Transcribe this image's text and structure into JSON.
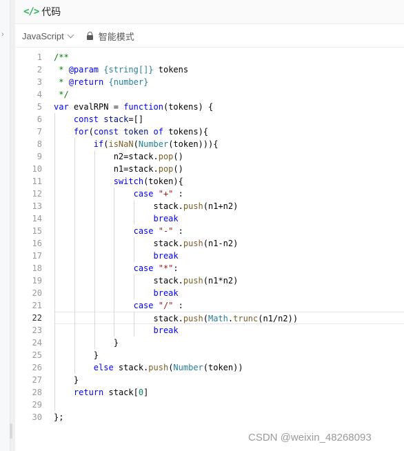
{
  "panel": {
    "title": "代码",
    "title_icon": "code-icon",
    "language_label": "JavaScript",
    "mode_label": "智能模式",
    "mode_icon": "lock-icon"
  },
  "editor": {
    "active_line": 22,
    "lines": [
      {
        "n": "1",
        "tokens": [
          {
            "t": "/**",
            "c": "com"
          }
        ]
      },
      {
        "n": "2",
        "tokens": [
          {
            "t": " * ",
            "c": "com"
          },
          {
            "t": "@param",
            "c": "tag"
          },
          {
            "t": " {string[]} ",
            "c": "type"
          },
          {
            "t": "tokens",
            "c": "op"
          }
        ]
      },
      {
        "n": "3",
        "tokens": [
          {
            "t": " * ",
            "c": "com"
          },
          {
            "t": "@return",
            "c": "tag"
          },
          {
            "t": " {number}",
            "c": "type"
          }
        ]
      },
      {
        "n": "4",
        "tokens": [
          {
            "t": " */",
            "c": "com"
          }
        ]
      },
      {
        "n": "5",
        "tokens": [
          {
            "t": "var",
            "c": "kw"
          },
          {
            "t": " evalRPN ",
            "c": "op"
          },
          {
            "t": "=",
            "c": "op"
          },
          {
            "t": " ",
            "c": "op"
          },
          {
            "t": "function",
            "c": "kw"
          },
          {
            "t": "(tokens) {",
            "c": "op"
          }
        ]
      },
      {
        "n": "6",
        "tokens": [
          {
            "t": "    ",
            "c": "op"
          },
          {
            "t": "const",
            "c": "kw"
          },
          {
            "t": " ",
            "c": "op"
          },
          {
            "t": "stack",
            "c": "var"
          },
          {
            "t": "=[]",
            "c": "op"
          }
        ]
      },
      {
        "n": "7",
        "tokens": [
          {
            "t": "    ",
            "c": "op"
          },
          {
            "t": "for",
            "c": "kw"
          },
          {
            "t": "(",
            "c": "op"
          },
          {
            "t": "const",
            "c": "kw"
          },
          {
            "t": " ",
            "c": "op"
          },
          {
            "t": "token",
            "c": "var"
          },
          {
            "t": " ",
            "c": "op"
          },
          {
            "t": "of",
            "c": "kw"
          },
          {
            "t": " tokens){",
            "c": "op"
          }
        ]
      },
      {
        "n": "8",
        "tokens": [
          {
            "t": "        ",
            "c": "op"
          },
          {
            "t": "if",
            "c": "kw"
          },
          {
            "t": "(",
            "c": "op"
          },
          {
            "t": "isNaN",
            "c": "fn"
          },
          {
            "t": "(",
            "c": "op"
          },
          {
            "t": "Number",
            "c": "type"
          },
          {
            "t": "(token))){",
            "c": "op"
          }
        ]
      },
      {
        "n": "9",
        "tokens": [
          {
            "t": "            n2=stack.",
            "c": "op"
          },
          {
            "t": "pop",
            "c": "fn"
          },
          {
            "t": "()",
            "c": "op"
          }
        ]
      },
      {
        "n": "10",
        "tokens": [
          {
            "t": "            n1=stack.",
            "c": "op"
          },
          {
            "t": "pop",
            "c": "fn"
          },
          {
            "t": "()",
            "c": "op"
          }
        ]
      },
      {
        "n": "11",
        "tokens": [
          {
            "t": "            ",
            "c": "op"
          },
          {
            "t": "switch",
            "c": "kw"
          },
          {
            "t": "(token){",
            "c": "op"
          }
        ]
      },
      {
        "n": "12",
        "tokens": [
          {
            "t": "                ",
            "c": "op"
          },
          {
            "t": "case",
            "c": "kw"
          },
          {
            "t": " ",
            "c": "op"
          },
          {
            "t": "\"+\"",
            "c": "str"
          },
          {
            "t": " :",
            "c": "op"
          }
        ]
      },
      {
        "n": "13",
        "tokens": [
          {
            "t": "                    stack.",
            "c": "op"
          },
          {
            "t": "push",
            "c": "fn"
          },
          {
            "t": "(n1+n2)",
            "c": "op"
          }
        ]
      },
      {
        "n": "14",
        "tokens": [
          {
            "t": "                    ",
            "c": "op"
          },
          {
            "t": "break",
            "c": "kw"
          }
        ]
      },
      {
        "n": "15",
        "tokens": [
          {
            "t": "                ",
            "c": "op"
          },
          {
            "t": "case",
            "c": "kw"
          },
          {
            "t": " ",
            "c": "op"
          },
          {
            "t": "\"-\"",
            "c": "str"
          },
          {
            "t": " :",
            "c": "op"
          }
        ]
      },
      {
        "n": "16",
        "tokens": [
          {
            "t": "                    stack.",
            "c": "op"
          },
          {
            "t": "push",
            "c": "fn"
          },
          {
            "t": "(n1-n2)",
            "c": "op"
          }
        ]
      },
      {
        "n": "17",
        "tokens": [
          {
            "t": "                    ",
            "c": "op"
          },
          {
            "t": "break",
            "c": "kw"
          }
        ]
      },
      {
        "n": "18",
        "tokens": [
          {
            "t": "                ",
            "c": "op"
          },
          {
            "t": "case",
            "c": "kw"
          },
          {
            "t": " ",
            "c": "op"
          },
          {
            "t": "\"*\"",
            "c": "str"
          },
          {
            "t": ":",
            "c": "op"
          }
        ]
      },
      {
        "n": "19",
        "tokens": [
          {
            "t": "                    stack.",
            "c": "op"
          },
          {
            "t": "push",
            "c": "fn"
          },
          {
            "t": "(n1*n2)",
            "c": "op"
          }
        ]
      },
      {
        "n": "20",
        "tokens": [
          {
            "t": "                    ",
            "c": "op"
          },
          {
            "t": "break",
            "c": "kw"
          }
        ]
      },
      {
        "n": "21",
        "tokens": [
          {
            "t": "                ",
            "c": "op"
          },
          {
            "t": "case",
            "c": "kw"
          },
          {
            "t": " ",
            "c": "op"
          },
          {
            "t": "\"/\"",
            "c": "str"
          },
          {
            "t": " :",
            "c": "op"
          }
        ]
      },
      {
        "n": "22",
        "tokens": [
          {
            "t": "                    stack.",
            "c": "op"
          },
          {
            "t": "push",
            "c": "fn"
          },
          {
            "t": "(",
            "c": "op"
          },
          {
            "t": "Math",
            "c": "type"
          },
          {
            "t": ".",
            "c": "op"
          },
          {
            "t": "trunc",
            "c": "fn"
          },
          {
            "t": "(n1/n2))",
            "c": "op"
          }
        ]
      },
      {
        "n": "23",
        "tokens": [
          {
            "t": "                    ",
            "c": "op"
          },
          {
            "t": "break",
            "c": "kw"
          }
        ]
      },
      {
        "n": "24",
        "tokens": [
          {
            "t": "            }",
            "c": "op"
          }
        ]
      },
      {
        "n": "25",
        "tokens": [
          {
            "t": "        }",
            "c": "op"
          }
        ]
      },
      {
        "n": "26",
        "tokens": [
          {
            "t": "        ",
            "c": "op"
          },
          {
            "t": "else",
            "c": "kw"
          },
          {
            "t": " stack.",
            "c": "op"
          },
          {
            "t": "push",
            "c": "fn"
          },
          {
            "t": "(",
            "c": "op"
          },
          {
            "t": "Number",
            "c": "type"
          },
          {
            "t": "(token))",
            "c": "op"
          }
        ]
      },
      {
        "n": "27",
        "tokens": [
          {
            "t": "    }",
            "c": "op"
          }
        ]
      },
      {
        "n": "28",
        "tokens": [
          {
            "t": "    ",
            "c": "op"
          },
          {
            "t": "return",
            "c": "kw"
          },
          {
            "t": " stack[",
            "c": "op"
          },
          {
            "t": "0",
            "c": "num"
          },
          {
            "t": "]",
            "c": "op"
          }
        ]
      },
      {
        "n": "29",
        "tokens": []
      },
      {
        "n": "30",
        "tokens": [
          {
            "t": "};",
            "c": "op"
          }
        ]
      }
    ]
  },
  "watermark": "CSDN @weixin_48268093"
}
